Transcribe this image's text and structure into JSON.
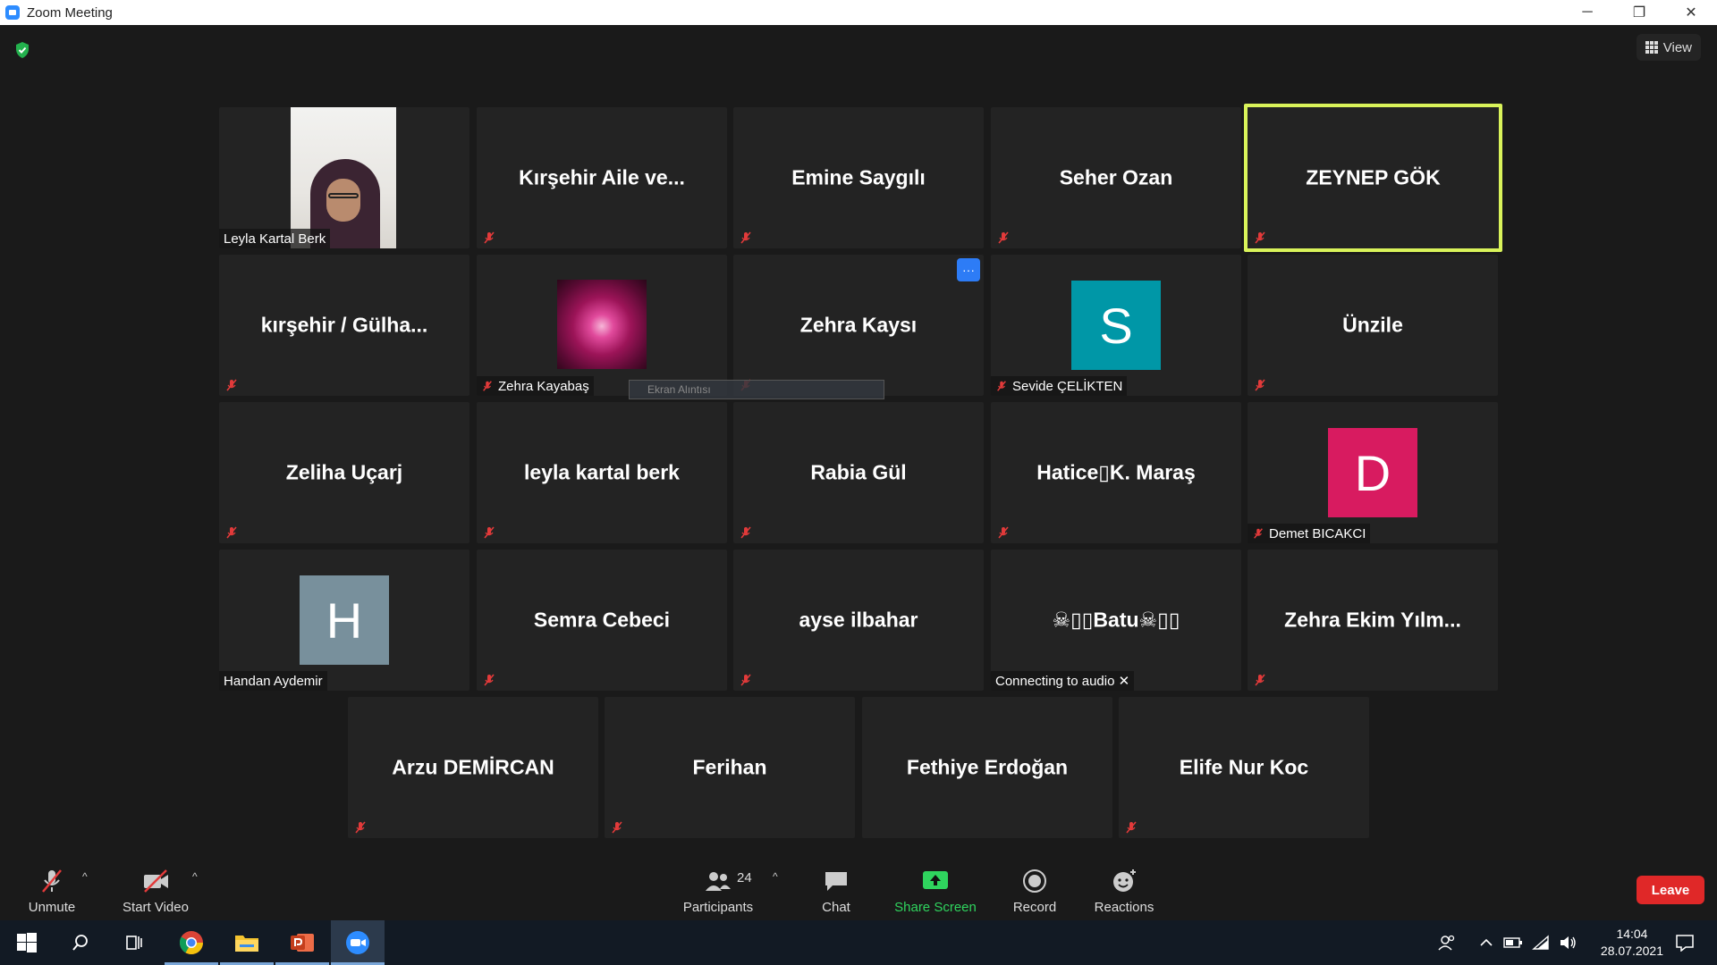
{
  "window": {
    "title": "Zoom Meeting",
    "minimize": "─",
    "restore": "❐",
    "close": "✕"
  },
  "header": {
    "view_label": "View"
  },
  "tiles": [
    {
      "name": "Leyla Kartal Berk",
      "label": "Leyla Kartal Berk"
    },
    {
      "name": "Kırşehir  Aile  ve..."
    },
    {
      "name": "Emine Saygılı"
    },
    {
      "name": "Seher Ozan"
    },
    {
      "name": "ZEYNEP GÖK"
    },
    {
      "name": "kırşehir  / Gülha..."
    },
    {
      "name": "Zehra Kayabaş",
      "label": "Zehra Kayabaş"
    },
    {
      "name": "Zehra Kaysı",
      "more": "···"
    },
    {
      "name": "Sevide ÇELİKTEN",
      "label": "Sevide ÇELİKTEN",
      "initial": "S"
    },
    {
      "name": "Ünzile"
    },
    {
      "name": "Zeliha Uçarj"
    },
    {
      "name": "leyla kartal berk"
    },
    {
      "name": "Rabia Gül"
    },
    {
      "name": "Hatice▯K.  Maraş"
    },
    {
      "name": "Demet BICAKCI",
      "label": "Demet BICAKCI",
      "initial": "D"
    },
    {
      "name": "Handan Aydemir",
      "label": "Handan Aydemir",
      "initial": "H"
    },
    {
      "name": "Semra Cebeci"
    },
    {
      "name": "ayse ilbahar"
    },
    {
      "name": "☠▯▯Batu☠▯▯",
      "label": "Connecting to audio ✕"
    },
    {
      "name": "Zehra  Ekim  Yılm..."
    },
    {
      "name": "Arzu DEMİRCAN"
    },
    {
      "name": "Ferihan"
    },
    {
      "name": "Fethiye Erdoğan"
    },
    {
      "name": "Elife Nur Koc"
    }
  ],
  "snip_tooltip": "Ekran Alıntısı",
  "toolbar": {
    "unmute": "Unmute",
    "start_video": "Start Video",
    "participants": "Participants",
    "participants_count": "24",
    "chat": "Chat",
    "share_screen": "Share Screen",
    "record": "Record",
    "reactions": "Reactions",
    "leave": "Leave"
  },
  "taskbar": {
    "time": "14:04",
    "date": "28.07.2021"
  },
  "colors": {
    "active_speaker": "#d9f35a",
    "avatar_s": "#0097a7",
    "avatar_d": "#d81b60",
    "avatar_h": "#78909c",
    "leave": "#e02828",
    "share_screen": "#2fd45e",
    "mute_icon": "#e23a3a"
  }
}
